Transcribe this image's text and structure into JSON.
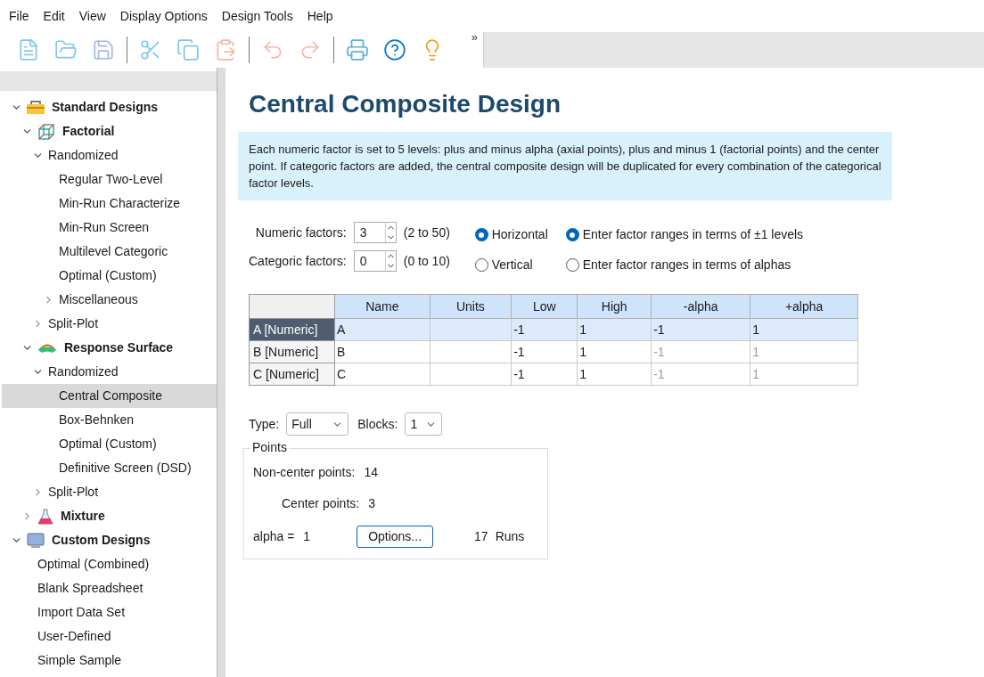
{
  "menu": [
    "File",
    "Edit",
    "View",
    "Display Options",
    "Design Tools",
    "Help"
  ],
  "toolbar": {
    "overflow": "»"
  },
  "tree": [
    {
      "label": "Standard Designs",
      "bold": true,
      "kind": "toolbox",
      "expanded": true,
      "selected": false,
      "children": [
        {
          "label": "Factorial",
          "bold": true,
          "kind": "cube",
          "expanded": true,
          "selected": false,
          "children": [
            {
              "label": "Randomized",
              "expanded": true,
              "selected": false,
              "children": [
                {
                  "label": "Regular Two-Level",
                  "selected": false
                },
                {
                  "label": "Min-Run Characterize",
                  "selected": false
                },
                {
                  "label": "Min-Run Screen",
                  "selected": false
                },
                {
                  "label": "Multilevel Categoric",
                  "selected": false
                },
                {
                  "label": "Optimal (Custom)",
                  "selected": false
                },
                {
                  "label": "Miscellaneous",
                  "expanded": false,
                  "selected": false
                }
              ]
            },
            {
              "label": "Split-Plot",
              "expanded": false,
              "selected": false
            }
          ]
        },
        {
          "label": "Response Surface",
          "bold": true,
          "kind": "surface",
          "expanded": true,
          "selected": false,
          "children": [
            {
              "label": "Randomized",
              "expanded": true,
              "selected": false,
              "children": [
                {
                  "label": "Central Composite",
                  "selected": true
                },
                {
                  "label": "Box-Behnken",
                  "selected": false
                },
                {
                  "label": "Optimal (Custom)",
                  "selected": false
                },
                {
                  "label": "Definitive Screen (DSD)",
                  "selected": false
                }
              ]
            },
            {
              "label": "Split-Plot",
              "expanded": false,
              "selected": false
            }
          ]
        },
        {
          "label": "Mixture",
          "bold": true,
          "kind": "flask",
          "expanded": false,
          "selected": false
        }
      ]
    },
    {
      "label": "Custom Designs",
      "bold": true,
      "kind": "monitor",
      "expanded": true,
      "selected": false,
      "children": [
        {
          "label": "Optimal (Combined)",
          "selected": false
        },
        {
          "label": "Blank Spreadsheet",
          "selected": false
        },
        {
          "label": "Import Data Set",
          "selected": false
        },
        {
          "label": "User-Defined",
          "selected": false
        },
        {
          "label": "Simple Sample",
          "selected": false
        }
      ]
    }
  ],
  "title": "Central Composite Design",
  "description": "Each numeric factor is set to 5 levels: plus and minus alpha (axial points), plus and minus 1 (factorial points) and the center point. If categoric factors are added, the central composite design will be duplicated for every combination of the categorical factor levels.",
  "factors": [
    {
      "label": "Numeric factors:",
      "value": "3",
      "range": "(2 to 50)"
    },
    {
      "label": "Categoric factors:",
      "value": "0",
      "range": "(0 to 10)"
    }
  ],
  "orientation": [
    {
      "label": "Horizontal",
      "selected": true
    },
    {
      "label": "Vertical",
      "selected": false
    }
  ],
  "range_mode": [
    {
      "label": "Enter factor ranges in terms of ±1 levels",
      "selected": true
    },
    {
      "label": "Enter factor ranges in terms of alphas",
      "selected": false
    }
  ],
  "table": {
    "columns": [
      "Name",
      "Units",
      "Low",
      "High",
      "-alpha",
      "+alpha"
    ],
    "rows": [
      {
        "header": "A [Numeric]",
        "selected": true,
        "alpha_disabled": false,
        "name": "A",
        "low": "-1",
        "high": "1",
        "minus_alpha": "-1",
        "plus_alpha": "1"
      },
      {
        "header": "B [Numeric]",
        "selected": false,
        "alpha_disabled": true,
        "name": "B",
        "low": "-1",
        "high": "1",
        "minus_alpha": "-1",
        "plus_alpha": "1"
      },
      {
        "header": "C [Numeric]",
        "selected": false,
        "alpha_disabled": true,
        "name": "C",
        "low": "-1",
        "high": "1",
        "minus_alpha": "-1",
        "plus_alpha": "1"
      }
    ]
  },
  "type": {
    "label": "Type:",
    "value": "Full"
  },
  "blocks": {
    "label": "Blocks:",
    "value": "1"
  },
  "points": {
    "title": "Points",
    "non_center_label": "Non-center points:",
    "non_center": "14",
    "center_label": "Center points:",
    "center": "3",
    "alpha_label": "alpha =",
    "alpha": "1",
    "options_button": "Options...",
    "runs": "17",
    "runs_label": "Runs"
  }
}
